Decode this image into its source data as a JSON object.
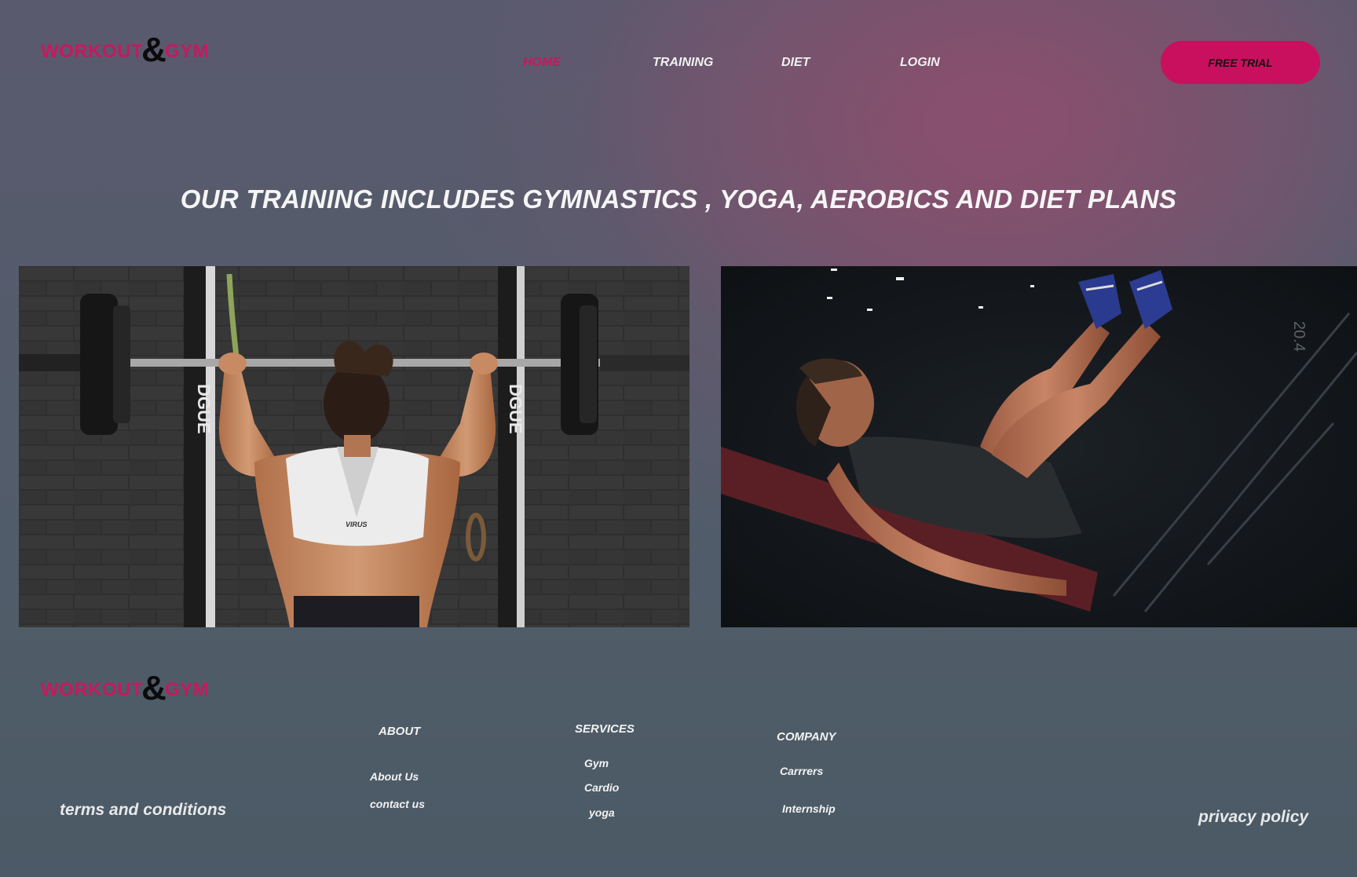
{
  "brand": {
    "left": "WORKOUT",
    "amp": "&",
    "right": "GYM"
  },
  "nav": {
    "items": [
      {
        "label": "HOME"
      },
      {
        "label": "TRAINING"
      },
      {
        "label": "DIET"
      },
      {
        "label": "LOGIN"
      }
    ],
    "cta": "FREE TRIAL"
  },
  "hero": {
    "headline": "OUR TRAINING INCLUDES GYMNASTICS , YOGA, AEROBICS AND DIET PLANS"
  },
  "photos": {
    "left": {
      "print": "VIRUS",
      "rack_text": "DGUE"
    },
    "right": {
      "watermark": "20.4"
    }
  },
  "footer": {
    "about": {
      "heading": "ABOUT",
      "links": [
        "About Us",
        "contact us"
      ]
    },
    "services": {
      "heading": "SERVICES",
      "links": [
        "Gym",
        "Cardio",
        "yoga"
      ]
    },
    "company": {
      "heading": "COMPANY",
      "links": [
        "Carrrers",
        "Internship"
      ]
    },
    "terms": "terms and conditions",
    "privacy": "privacy policy"
  },
  "colors": {
    "accent": "#c8185f",
    "button": "#c8105e"
  }
}
